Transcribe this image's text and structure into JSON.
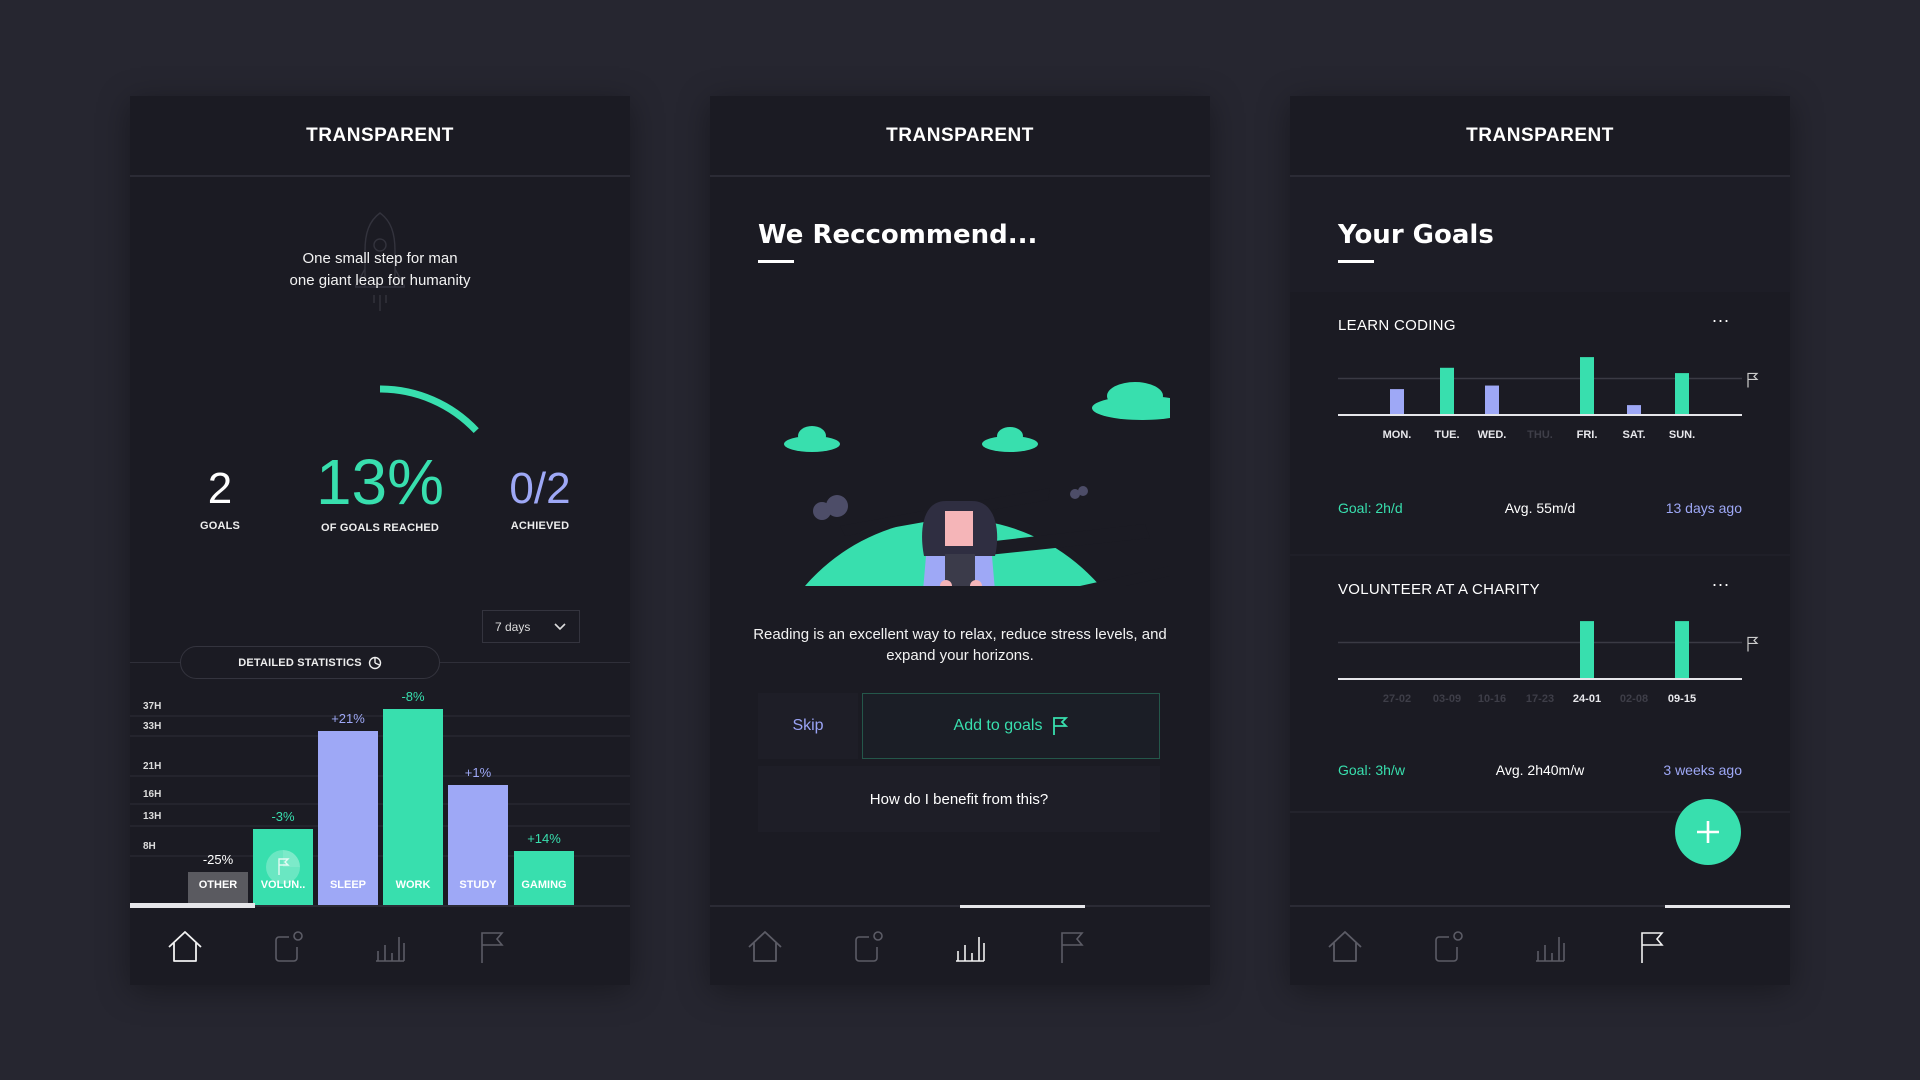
{
  "app_title": "TRANSPARENT",
  "colors": {
    "accent_green": "#38dfae",
    "accent_purple": "#9ea8f6",
    "other_gray": "#5a5a60",
    "bg": "#262630",
    "panel": "#1b1b23"
  },
  "nav": {
    "items": [
      {
        "name": "home",
        "icon": "home-icon"
      },
      {
        "name": "notifications",
        "icon": "notification-square-icon"
      },
      {
        "name": "statistics",
        "icon": "bar-chart-icon"
      },
      {
        "name": "goals",
        "icon": "flag-icon"
      }
    ]
  },
  "home": {
    "quote_line1": "One small step for man",
    "quote_line2": "one giant leap for humanity",
    "progress_fraction": 0.13,
    "stats": [
      {
        "value": "2",
        "label": "GOALS"
      },
      {
        "value": "13%",
        "label": "OF GOALS REACHED"
      },
      {
        "value": "0/2",
        "label": "ACHIEVED"
      }
    ],
    "period_select": "7 days",
    "detailed_stats_label": "DETAILED STATISTICS",
    "active_nav": "home"
  },
  "chart_data": [
    {
      "type": "bar",
      "title": "DETAILED STATISTICS",
      "categories": [
        "OTHER",
        "VOLUN..",
        "SLEEP",
        "WORK",
        "STUDY",
        "GAMING"
      ],
      "values": [
        6,
        14,
        32,
        36,
        22,
        10
      ],
      "changes": [
        "-25%",
        "-3%",
        "+21%",
        "-8%",
        "+1%",
        "+14%"
      ],
      "colors": [
        "#5a5a60",
        "#38dfae",
        "#9ea8f6",
        "#38dfae",
        "#9ea8f6",
        "#38dfae"
      ],
      "change_colors": [
        "#ffffff",
        "#38dfae",
        "#9ea8f6",
        "#38dfae",
        "#9ea8f6",
        "#38dfae"
      ],
      "ytick_labels": [
        "37H",
        "33H",
        "21H",
        "16H",
        "13H",
        "8H"
      ],
      "ylabel": "hours",
      "xlabel": "",
      "ylim": [
        0,
        37
      ]
    },
    {
      "type": "bar",
      "title": "LEARN CODING",
      "categories": [
        "MON.",
        "TUE.",
        "WED.",
        "THU.",
        "FRI.",
        "SAT.",
        "SUN."
      ],
      "values": [
        0.7,
        1.3,
        0.8,
        0,
        1.6,
        0.25,
        1.15
      ],
      "colors": [
        "#9ea8f6",
        "#38dfae",
        "#9ea8f6",
        "#9ea8f6",
        "#38dfae",
        "#9ea8f6",
        "#38dfae"
      ],
      "goal_line": 1.0,
      "ylim": [
        0,
        1.8
      ]
    },
    {
      "type": "bar",
      "title": "VOLUNTEER AT A CHARITY",
      "categories": [
        "27-02",
        "03-09",
        "10-16",
        "17-23",
        "24-01",
        "02-08",
        "09-15"
      ],
      "values": [
        0,
        0,
        0,
        0,
        1.6,
        0,
        1.6
      ],
      "colors": [
        "#38dfae",
        "#38dfae",
        "#38dfae",
        "#38dfae",
        "#38dfae",
        "#38dfae",
        "#38dfae"
      ],
      "goal_line": 1.0,
      "ylim": [
        0,
        1.8
      ]
    }
  ],
  "recommend": {
    "title": "We Reccommend...",
    "description": "Reading is an excellent way to relax, reduce stress levels, and expand your horizons.",
    "skip_label": "Skip",
    "add_label": "Add to goals",
    "benefit_label": "How do I benefit from this?",
    "active_nav": "statistics"
  },
  "goals": {
    "title": "Your Goals",
    "cards": [
      {
        "title": "LEARN CODING",
        "goal": "Goal: 2h/d",
        "avg": "Avg. 55m/d",
        "ago": "13 days ago",
        "highlight": [
          0,
          1,
          2,
          4,
          5,
          6
        ]
      },
      {
        "title": "VOLUNTEER AT A CHARITY",
        "goal": "Goal: 3h/w",
        "avg": "Avg. 2h40m/w",
        "ago": "3 weeks ago",
        "highlight": [
          4,
          6
        ]
      }
    ],
    "more_label": "...",
    "active_nav": "goals"
  }
}
